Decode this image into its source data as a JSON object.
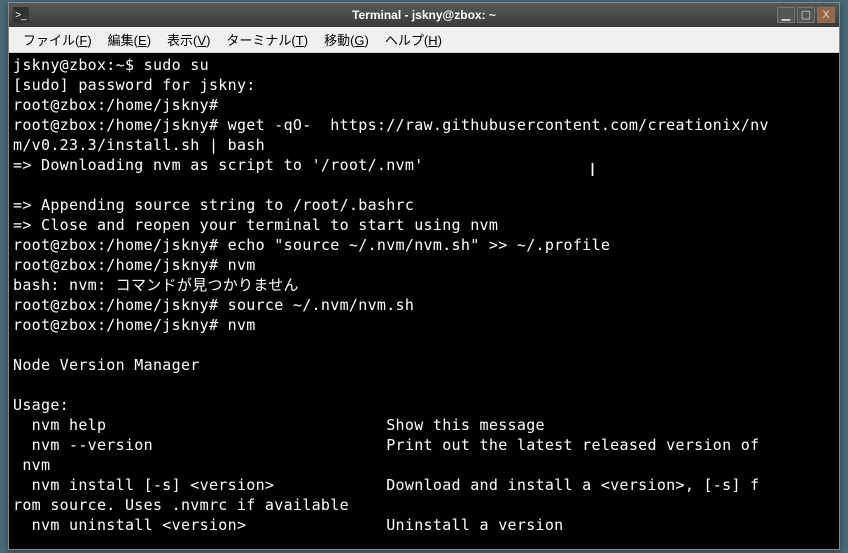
{
  "window": {
    "title": "Terminal - jskny@zbox: ~",
    "minimize_icon": "▁",
    "maximize_icon": "▢",
    "close_icon": "X"
  },
  "menubar": {
    "file": {
      "label": "ファイル",
      "accel": "F"
    },
    "edit": {
      "label": "編集",
      "accel": "E"
    },
    "view": {
      "label": "表示",
      "accel": "V"
    },
    "terminal": {
      "label": "ターミナル",
      "accel": "T"
    },
    "go": {
      "label": "移動",
      "accel": "G"
    },
    "help": {
      "label": "ヘルプ",
      "accel": "H"
    }
  },
  "terminal_content": "jskny@zbox:~$ sudo su\n[sudo] password for jskny:\nroot@zbox:/home/jskny#\nroot@zbox:/home/jskny# wget -qO-  https://raw.githubusercontent.com/creationix/nv\nm/v0.23.3/install.sh | bash\n=> Downloading nvm as script to '/root/.nvm'\n\n=> Appending source string to /root/.bashrc\n=> Close and reopen your terminal to start using nvm\nroot@zbox:/home/jskny# echo \"source ~/.nvm/nvm.sh\" >> ~/.profile\nroot@zbox:/home/jskny# nvm\nbash: nvm: コマンドが見つかりません\nroot@zbox:/home/jskny# source ~/.nvm/nvm.sh\nroot@zbox:/home/jskny# nvm\n\nNode Version Manager\n\nUsage:\n  nvm help                              Show this message\n  nvm --version                         Print out the latest released version of\n nvm\n  nvm install [-s] <version>            Download and install a <version>, [-s] f\nrom source. Uses .nvmrc if available\n  nvm uninstall <version>               Uninstall a version"
}
